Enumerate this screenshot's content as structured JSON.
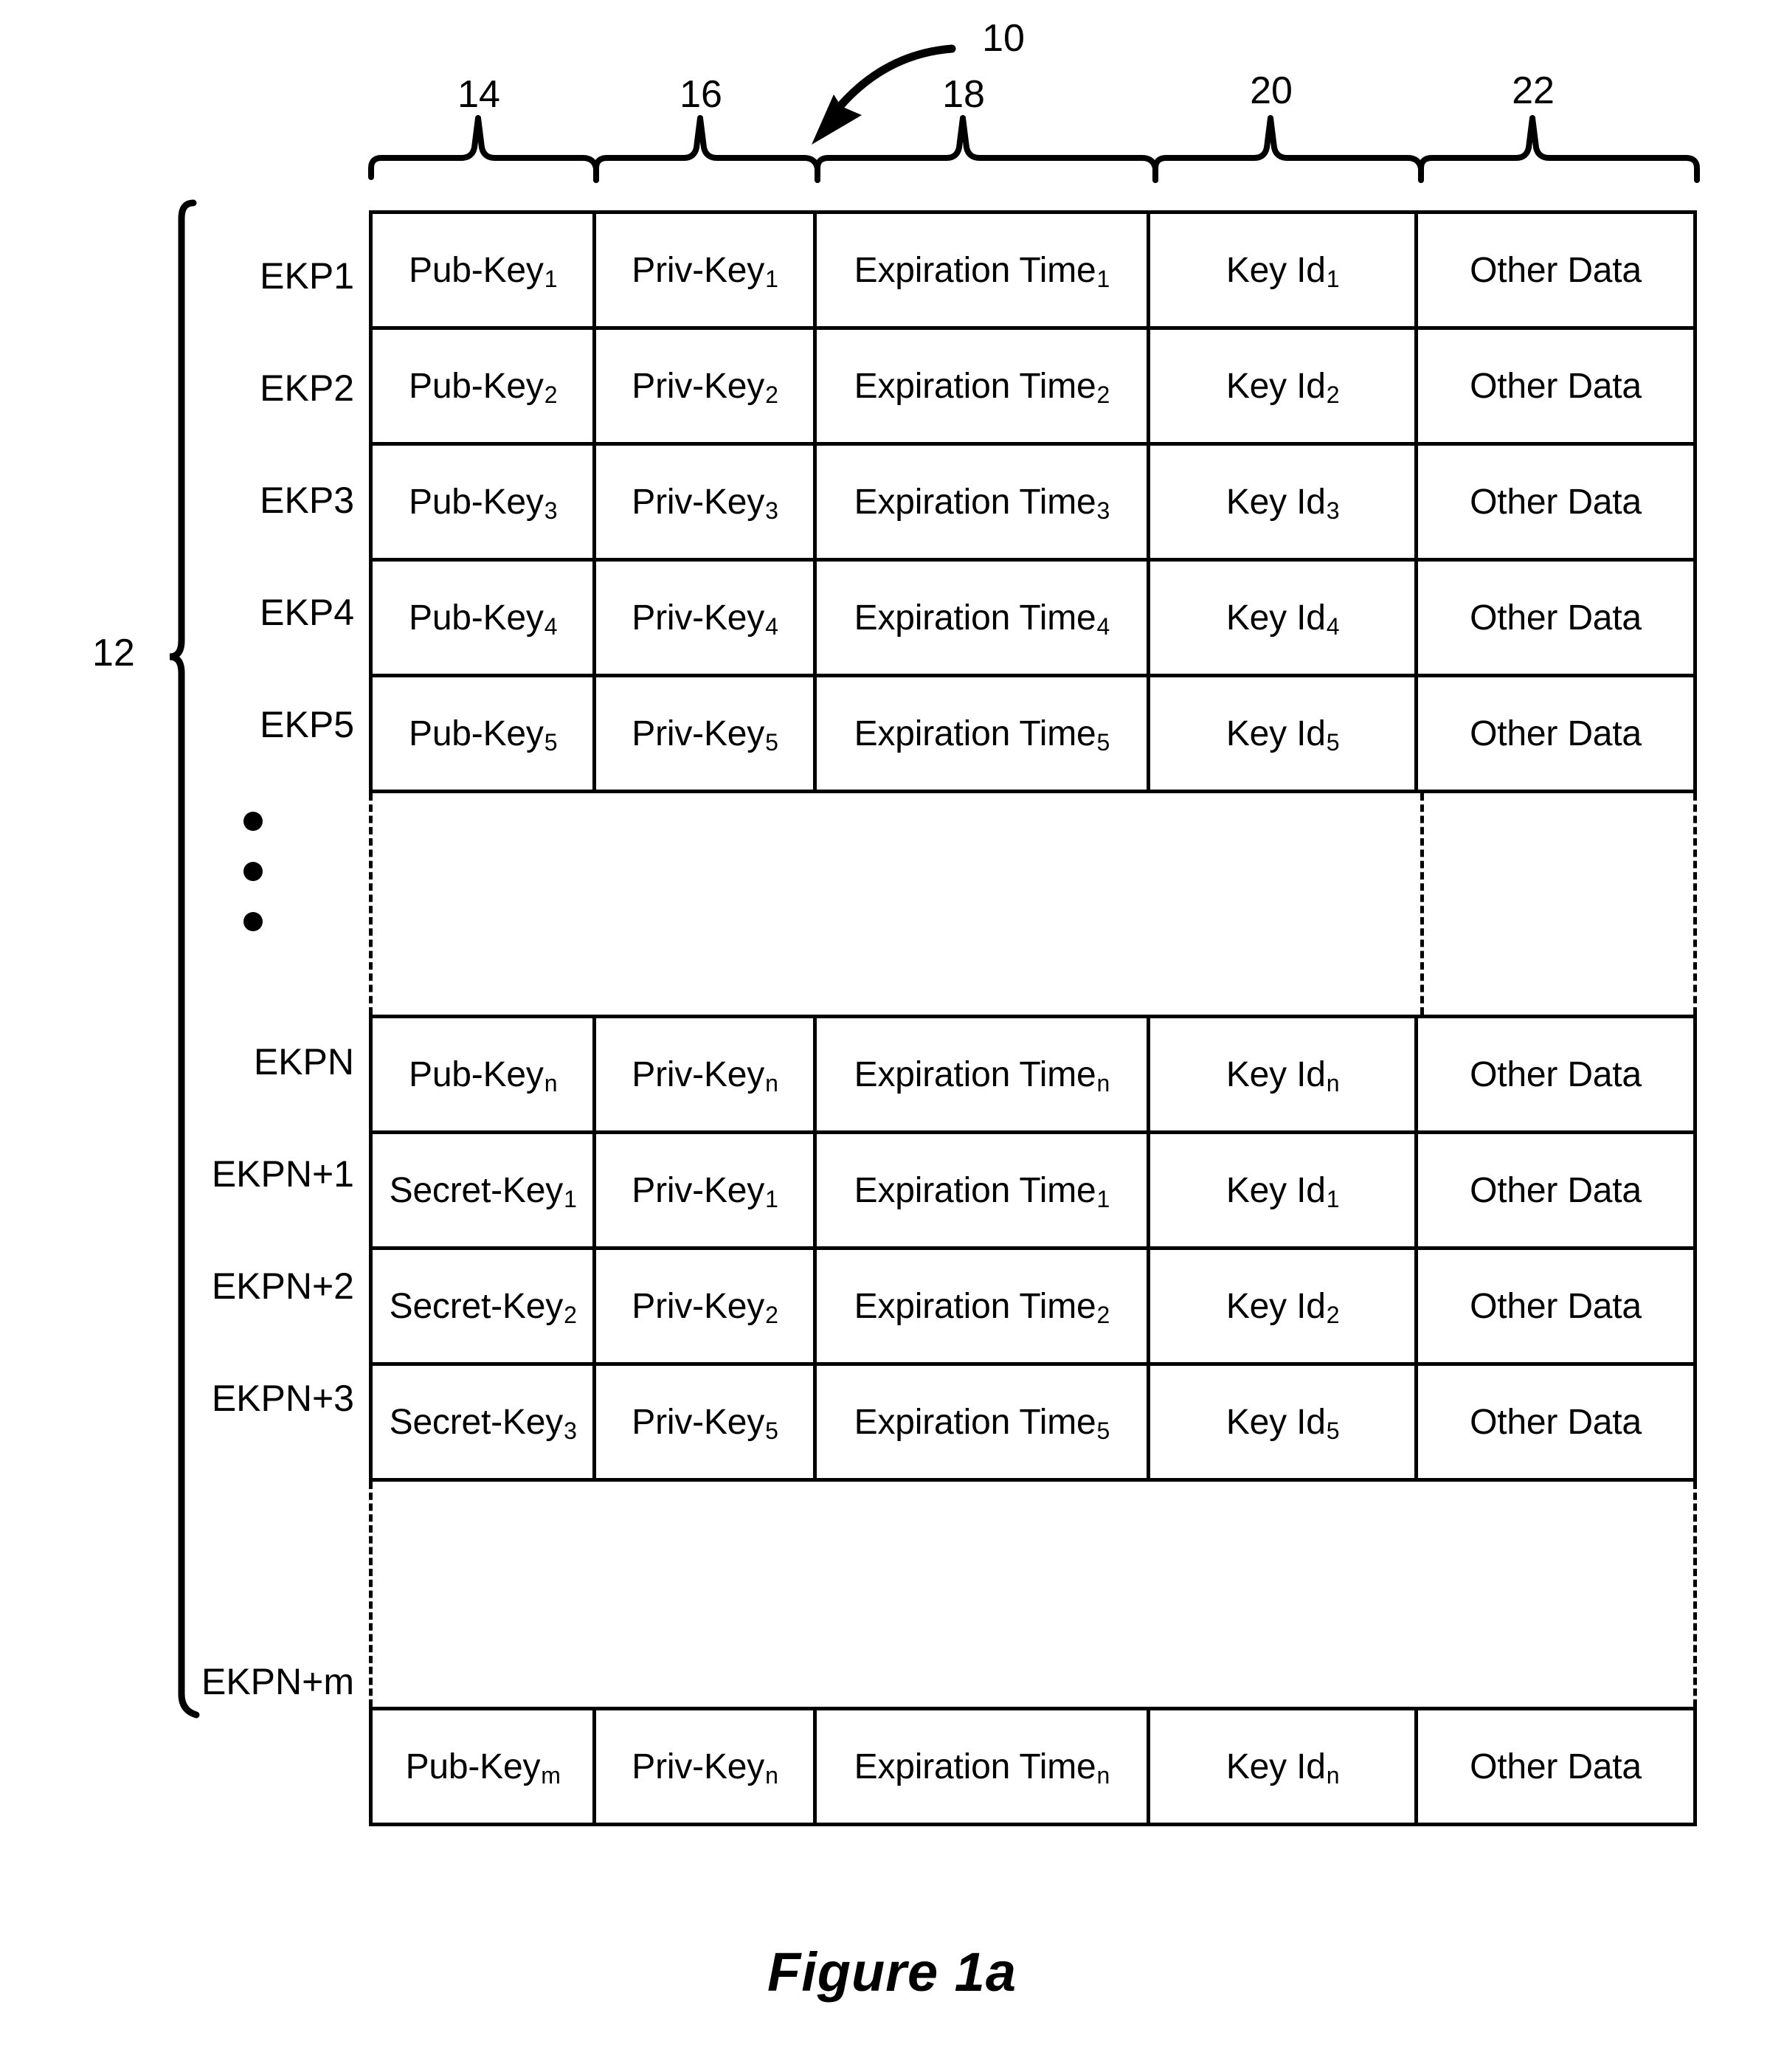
{
  "figure": {
    "caption": "Figure 1a",
    "table_ref": "10",
    "rows_bracket_ref": "12"
  },
  "column_refs": [
    {
      "ref": "14",
      "for": "Pub-Key"
    },
    {
      "ref": "16",
      "for": "Priv-Key"
    },
    {
      "ref": "18",
      "for": "Expiration Time"
    },
    {
      "ref": "20",
      "for": "Key Id"
    },
    {
      "ref": "22",
      "for": "Other Data"
    }
  ],
  "table": {
    "row_labels": [
      "EKP1",
      "EKP2",
      "EKP3",
      "EKP4",
      "EKP5",
      "EKPN",
      "EKPN+1",
      "EKPN+2",
      "EKPN+3",
      "EKPN+m"
    ],
    "groups": [
      {
        "id": "group-top",
        "rows": [
          {
            "label": "EKP1",
            "key": "Pub-Key",
            "key_sub": "1",
            "priv": "Priv-Key",
            "priv_sub": "1",
            "exp": "Expiration Time",
            "exp_sub": "1",
            "keyid": "Key Id",
            "keyid_sub": "1",
            "other": "Other Data"
          },
          {
            "label": "EKP2",
            "key": "Pub-Key",
            "key_sub": "2",
            "priv": "Priv-Key",
            "priv_sub": "2",
            "exp": "Expiration Time",
            "exp_sub": "2",
            "keyid": "Key Id",
            "keyid_sub": "2",
            "other": "Other Data"
          },
          {
            "label": "EKP3",
            "key": "Pub-Key",
            "key_sub": "3",
            "priv": "Priv-Key",
            "priv_sub": "3",
            "exp": "Expiration Time",
            "exp_sub": "3",
            "keyid": "Key Id",
            "keyid_sub": "3",
            "other": "Other Data"
          },
          {
            "label": "EKP4",
            "key": "Pub-Key",
            "key_sub": "4",
            "priv": "Priv-Key",
            "priv_sub": "4",
            "exp": "Expiration Time",
            "exp_sub": "4",
            "keyid": "Key Id",
            "keyid_sub": "4",
            "other": "Other Data"
          },
          {
            "label": "EKP5",
            "key": "Pub-Key",
            "key_sub": "5",
            "priv": "Priv-Key",
            "priv_sub": "5",
            "exp": "Expiration Time",
            "exp_sub": "5",
            "keyid": "Key Id",
            "keyid_sub": "5",
            "other": "Other Data"
          }
        ]
      },
      {
        "id": "group-middle",
        "rows": [
          {
            "label": "EKPN",
            "key": "Pub-Key",
            "key_sub": "n",
            "priv": "Priv-Key",
            "priv_sub": "n",
            "exp": "Expiration Time",
            "exp_sub": "n",
            "keyid": "Key Id",
            "keyid_sub": "n",
            "other": "Other Data"
          },
          {
            "label": "EKPN+1",
            "key": "Secret-Key",
            "key_sub": "1",
            "priv": "Priv-Key",
            "priv_sub": "1",
            "exp": "Expiration Time",
            "exp_sub": "1",
            "keyid": "Key Id",
            "keyid_sub": "1",
            "other": "Other Data"
          },
          {
            "label": "EKPN+2",
            "key": "Secret-Key",
            "key_sub": "2",
            "priv": "Priv-Key",
            "priv_sub": "2",
            "exp": "Expiration Time",
            "exp_sub": "2",
            "keyid": "Key Id",
            "keyid_sub": "2",
            "other": "Other Data"
          },
          {
            "label": "EKPN+3",
            "key": "Secret-Key",
            "key_sub": "3",
            "priv": "Priv-Key",
            "priv_sub": "5",
            "exp": "Expiration Time",
            "exp_sub": "5",
            "keyid": "Key Id",
            "keyid_sub": "5",
            "other": "Other Data"
          }
        ]
      },
      {
        "id": "group-last",
        "rows": [
          {
            "label": "EKPN+m",
            "key": "Pub-Key",
            "key_sub": "m",
            "priv": "Priv-Key",
            "priv_sub": "n",
            "exp": "Expiration Time",
            "exp_sub": "n",
            "keyid": "Key Id",
            "keyid_sub": "n",
            "other": "Other Data"
          }
        ]
      }
    ]
  },
  "colors": {
    "ink": "#000000",
    "paper": "#ffffff"
  }
}
